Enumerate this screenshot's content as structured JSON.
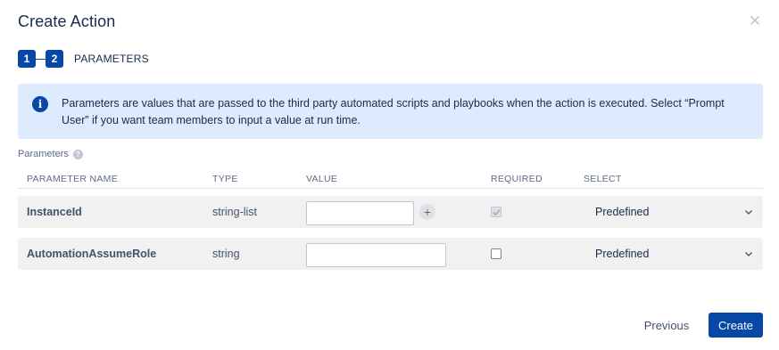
{
  "dialog": {
    "title": "Create Action",
    "close_icon": "close-icon"
  },
  "stepper": {
    "steps": [
      "1",
      "2"
    ],
    "current_label": "PARAMETERS"
  },
  "info": {
    "icon": "info-icon",
    "text": "Parameters are values that are passed to the third party automated scripts and playbooks when the action is executed. Select “Prompt User” if you want team members to input a value at run time."
  },
  "parameters": {
    "label": "Parameters",
    "help_icon": "help-icon",
    "headers": [
      "PARAMETER NAME",
      "TYPE",
      "VALUE",
      "REQUIRED",
      "SELECT"
    ],
    "rows": [
      {
        "name": "InstanceId",
        "type": "string-list",
        "value": "",
        "required": true,
        "required_disabled": true,
        "select": "Predefined",
        "has_add": true
      },
      {
        "name": "AutomationAssumeRole",
        "type": "string",
        "value": "",
        "required": false,
        "required_disabled": false,
        "select": "Predefined",
        "has_add": false
      }
    ]
  },
  "footer": {
    "previous_label": "Previous",
    "create_label": "Create"
  },
  "colors": {
    "primary": "#0747a6",
    "info_bg": "#deebff",
    "row_bg": "#f1f1f1"
  }
}
